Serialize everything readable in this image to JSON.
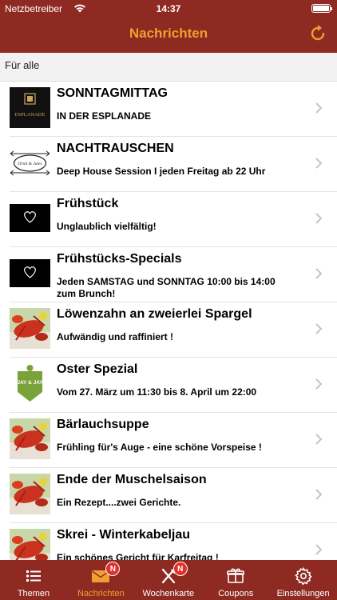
{
  "status_bar": {
    "carrier": "Netzbetreiber",
    "time": "14:37"
  },
  "nav": {
    "title": "Nachrichten"
  },
  "section": {
    "label": "Für alle"
  },
  "messages": [
    {
      "title": "SONNTAGMITTAG",
      "subtitle": "IN DER ESPLANADE",
      "thumb": "esplanade-logo",
      "thumb_text": "ESPLANADE"
    },
    {
      "title": "NACHTRAUSCHEN",
      "subtitle": "Deep House Session I jeden Freitag ab 22 Uhr",
      "thumb": "oval-logo",
      "thumb_text": "Ornit & Jules"
    },
    {
      "title": "Frühstück",
      "subtitle": "Unglaublich vielfältig!",
      "thumb": "black-heart-tile"
    },
    {
      "title": "Frühstücks-Specials",
      "subtitle": "Jeden SAMSTAG und SONNTAG 10:00 bis 14:00 zum Brunch!",
      "thumb": "black-heart-tile"
    },
    {
      "title": "Löwenzahn an zweierlei Spargel",
      "subtitle": "Aufwändig und raffiniert !",
      "thumb": "lobster-photo"
    },
    {
      "title": "Oster Spezial",
      "subtitle": "Vom 27. März um 11:30 bis 8. April um 22:00",
      "thumb": "jay-and-jay-badge",
      "thumb_text": "JAY & JAY"
    },
    {
      "title": "Bärlauchsuppe",
      "subtitle": "Frühling für's Auge - eine schöne Vorspeise !",
      "thumb": "lobster-photo"
    },
    {
      "title": "Ende der Muschelsaison",
      "subtitle": "Ein Rezept....zwei Gerichte.",
      "thumb": "lobster-photo"
    },
    {
      "title": "Skrei - Winterkabeljau",
      "subtitle": "Ein schönes Gericht für Karfreitag !",
      "thumb": "lobster-photo"
    }
  ],
  "tabs": [
    {
      "label": "Themen",
      "icon": "list-icon",
      "active": false,
      "badge": ""
    },
    {
      "label": "Nachrichten",
      "icon": "envelope-icon",
      "active": true,
      "badge": "N"
    },
    {
      "label": "Wochenkarte",
      "icon": "cutlery-icon",
      "active": false,
      "badge": "N"
    },
    {
      "label": "Coupons",
      "icon": "gift-icon",
      "active": false,
      "badge": ""
    },
    {
      "label": "Einstellungen",
      "icon": "gear-icon",
      "active": false,
      "badge": ""
    }
  ],
  "colors": {
    "bar": "#8e2a22",
    "accent": "#f0a030",
    "badge": "#e0302a"
  }
}
